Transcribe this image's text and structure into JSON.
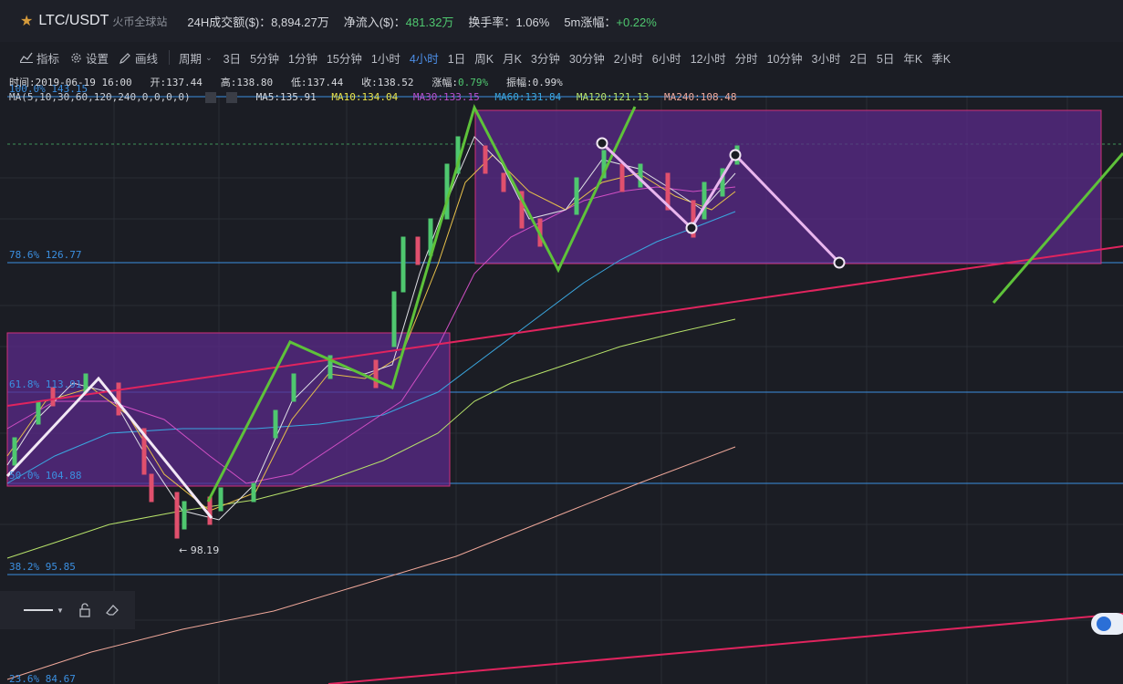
{
  "header": {
    "pair": "LTC/USDT",
    "exchange": "火币全球站",
    "stats": [
      {
        "label": "24H成交额($)：",
        "value": "8,894.27万",
        "color": "white"
      },
      {
        "label": "净流入($)：",
        "value": "481.32万",
        "color": "green"
      },
      {
        "label": "换手率：",
        "value": "1.06%",
        "color": "white"
      },
      {
        "label": "5m涨幅：",
        "value": "+0.22%",
        "color": "green"
      }
    ]
  },
  "toolbar": {
    "indicators": "指标",
    "settings": "设置",
    "draw": "画线",
    "period_label": "周期",
    "periods": [
      "3日",
      "5分钟",
      "1分钟",
      "15分钟",
      "1小时",
      "4小时",
      "1日",
      "周K",
      "月K",
      "3分钟",
      "30分钟",
      "2小时",
      "6小时",
      "12小时",
      "分时",
      "10分钟",
      "3小时",
      "2日",
      "5日",
      "年K",
      "季K"
    ],
    "active_period": "4小时"
  },
  "ohlc": {
    "time": "时间:2019-06-19 16:00",
    "open": "开:137.44",
    "high": "高:138.80",
    "low": "低:137.44",
    "close": "收:138.52",
    "change_label": "涨幅:",
    "change_value": "0.79%",
    "amplitude": "振幅:0.99%"
  },
  "ma": {
    "params": "MA(5,10,30,60,120,240,0,0,0,0)",
    "items": [
      {
        "text": "MA5:135.91",
        "color": "#d7d9de"
      },
      {
        "text": "MA10:134.04",
        "color": "#e8e34a"
      },
      {
        "text": "MA30:133.15",
        "color": "#b84fd0"
      },
      {
        "text": "MA60:131.84",
        "color": "#3aa7e0"
      },
      {
        "text": "MA120:121.13",
        "color": "#b7e26a"
      },
      {
        "text": "MA240:108.48",
        "color": "#f0a89a"
      }
    ]
  },
  "fib_levels": [
    {
      "label": "100.0% 143.15"
    },
    {
      "label": "78.6% 126.77"
    },
    {
      "label": "61.8% 113.91"
    },
    {
      "label": "50.0% 104.88"
    },
    {
      "label": "38.2% 95.85"
    },
    {
      "label": "23.6% 84.67"
    }
  ],
  "low_marker": "← 98.19",
  "colors": {
    "background": "#1b1d24",
    "accent": "#4d8fe8",
    "up": "#4fc76f",
    "down": "#e0506d",
    "box": "#5b2a8a"
  }
}
